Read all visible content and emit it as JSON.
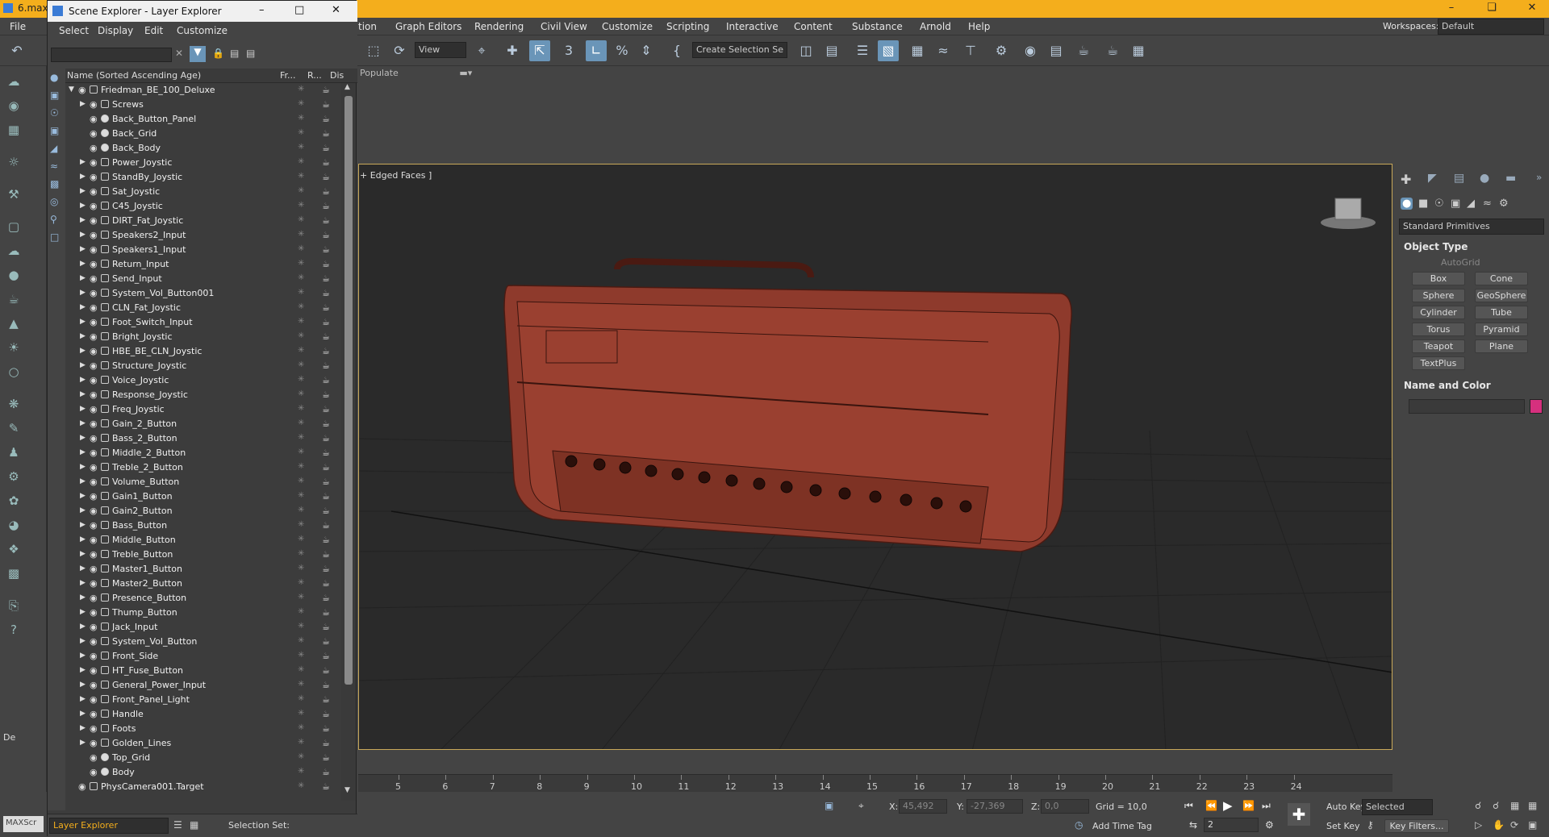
{
  "app": {
    "file_name": "6.max"
  },
  "main_menu": [
    "tion",
    "Graph Editors",
    "Rendering",
    "Civil View",
    "Customize",
    "Scripting",
    "Interactive",
    "Content",
    "Substance",
    "Arnold",
    "Help"
  ],
  "file_menu": "File",
  "workspace": {
    "label": "Workspaces:",
    "value": "Default"
  },
  "toolbar": {
    "view_combo": "View",
    "selection_set_combo": "Create Selection Se"
  },
  "populate_label": "Populate",
  "scene_explorer": {
    "title": "Scene Explorer - Layer Explorer",
    "menu": [
      "Select",
      "Display",
      "Edit",
      "Customize"
    ],
    "columns": {
      "name": "Name (Sorted Ascending Age)",
      "frozen": "Fr...",
      "render": "R...",
      "display": "Dis"
    },
    "root": "Friedman_BE_100_Deluxe",
    "items": [
      {
        "name": "Screws",
        "expand": true
      },
      {
        "name": "Back_Button_Panel",
        "expand": false
      },
      {
        "name": "Back_Grid",
        "expand": false
      },
      {
        "name": "Back_Body",
        "expand": false
      },
      {
        "name": "Power_Joystic",
        "expand": true
      },
      {
        "name": "StandBy_Joystic",
        "expand": true
      },
      {
        "name": "Sat_Joystic",
        "expand": true
      },
      {
        "name": "C45_Joystic",
        "expand": true
      },
      {
        "name": "DIRT_Fat_Joystic",
        "expand": true
      },
      {
        "name": "Speakers2_Input",
        "expand": true
      },
      {
        "name": "Speakers1_Input",
        "expand": true
      },
      {
        "name": "Return_Input",
        "expand": true
      },
      {
        "name": "Send_Input",
        "expand": true
      },
      {
        "name": "System_Vol_Button001",
        "expand": true
      },
      {
        "name": "CLN_Fat_Joystic",
        "expand": true
      },
      {
        "name": "Foot_Switch_Input",
        "expand": true
      },
      {
        "name": "Bright_Joystic",
        "expand": true
      },
      {
        "name": "HBE_BE_CLN_Joystic",
        "expand": true
      },
      {
        "name": "Structure_Joystic",
        "expand": true
      },
      {
        "name": "Voice_Joystic",
        "expand": true
      },
      {
        "name": "Response_Joystic",
        "expand": true
      },
      {
        "name": "Freq_Joystic",
        "expand": true
      },
      {
        "name": "Gain_2_Button",
        "expand": true
      },
      {
        "name": "Bass_2_Button",
        "expand": true
      },
      {
        "name": "Middle_2_Button",
        "expand": true
      },
      {
        "name": "Treble_2_Button",
        "expand": true
      },
      {
        "name": "Volume_Button",
        "expand": true
      },
      {
        "name": "Gain1_Button",
        "expand": true
      },
      {
        "name": "Gain2_Button",
        "expand": true
      },
      {
        "name": "Bass_Button",
        "expand": true
      },
      {
        "name": "Middle_Button",
        "expand": true
      },
      {
        "name": "Treble_Button",
        "expand": true
      },
      {
        "name": "Master1_Button",
        "expand": true
      },
      {
        "name": "Master2_Button",
        "expand": true
      },
      {
        "name": "Presence_Button",
        "expand": true
      },
      {
        "name": "Thump_Button",
        "expand": true
      },
      {
        "name": "Jack_Input",
        "expand": true
      },
      {
        "name": "System_Vol_Button",
        "expand": true
      },
      {
        "name": "Front_Side",
        "expand": true
      },
      {
        "name": "HT_Fuse_Button",
        "expand": true
      },
      {
        "name": "General_Power_Input",
        "expand": true
      },
      {
        "name": "Front_Panel_Light",
        "expand": true
      },
      {
        "name": "Handle",
        "expand": true
      },
      {
        "name": "Foots",
        "expand": true
      },
      {
        "name": "Golden_Lines",
        "expand": true
      },
      {
        "name": "Top_Grid",
        "expand": false
      },
      {
        "name": "Body",
        "expand": false
      }
    ],
    "camera_target": "PhysCamera001.Target",
    "bottom": {
      "explorer_combo": "Layer Explorer",
      "selection_set": "Selection Set:"
    }
  },
  "viewport": {
    "label": "+ Edged Faces ]"
  },
  "command_panel": {
    "category": "Standard Primitives",
    "object_type_header": "Object Type",
    "autogrid": "AutoGrid",
    "buttons": [
      "Box",
      "Cone",
      "Sphere",
      "GeoSphere",
      "Cylinder",
      "Tube",
      "Torus",
      "Pyramid",
      "Teapot",
      "Plane",
      "TextPlus"
    ],
    "name_color_header": "Name and Color",
    "color_swatch": "#d6307e"
  },
  "timeline": {
    "ticks": [
      "5",
      "6",
      "7",
      "8",
      "9",
      "10",
      "11",
      "12",
      "13",
      "14",
      "15",
      "16",
      "17",
      "18",
      "19",
      "20",
      "21",
      "22",
      "23",
      "24"
    ]
  },
  "status": {
    "x_label": "X:",
    "x_value": "45,492",
    "y_label": "Y:",
    "y_value": "-27,369",
    "z_label": "Z:",
    "z_value": "0,0",
    "grid": "Grid = 10,0",
    "add_time_tag": "Add Time Tag",
    "auto_key": "Auto Key",
    "selected": "Selected",
    "set_key": "Set Key",
    "key_filters": "Key Filters...",
    "frame": "2",
    "left_label": "De",
    "maxscript": "MAXScr"
  },
  "colors": {
    "title_bar": "#f4ae1c",
    "model": "#8e3a2c",
    "accent": "#6a95b8"
  }
}
